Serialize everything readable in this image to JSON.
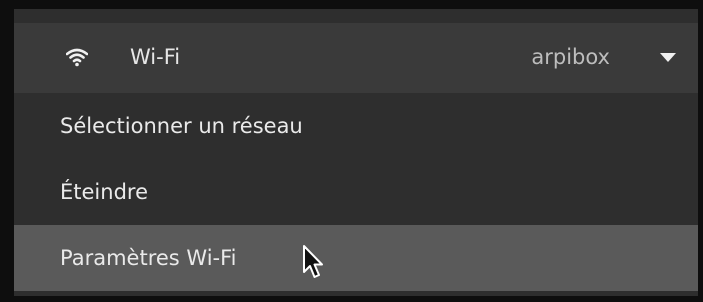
{
  "status_menu": {
    "wifi": {
      "icon": "wifi-icon",
      "label": "Wi-Fi",
      "network_name": "arpibox",
      "expand_icon": "chevron-down-icon"
    },
    "items": [
      {
        "label": "Sélectionner un réseau"
      },
      {
        "label": "Éteindre"
      },
      {
        "label": "Paramètres Wi-Fi",
        "hovered": true
      }
    ]
  },
  "cursor": {
    "icon": "mouse-pointer-icon"
  },
  "colors": {
    "header_bg": "#3a3a3a",
    "menu_bg": "#2e2e2e",
    "hover_bg": "#5a5a5a",
    "text": "#eaeaea",
    "muted_text": "#bdbdbd"
  }
}
